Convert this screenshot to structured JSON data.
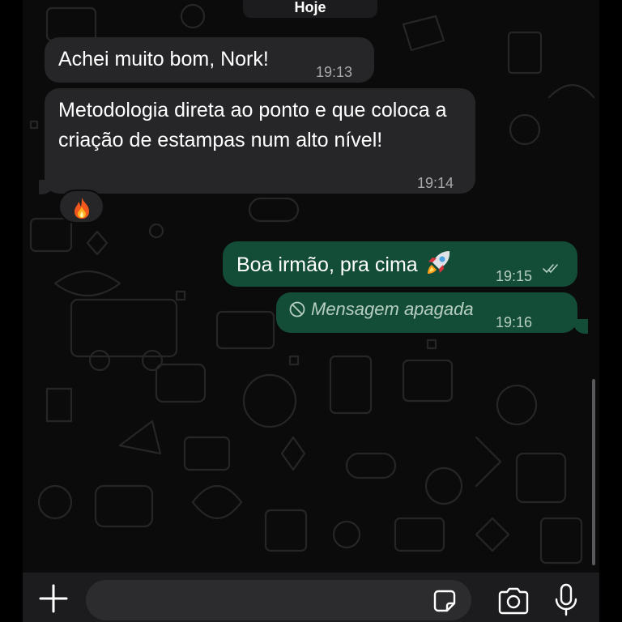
{
  "date_separator": "Hoje",
  "messages": [
    {
      "direction": "incoming",
      "text": "Achei muito bom, Nork!",
      "time": "19:13"
    },
    {
      "direction": "incoming",
      "text": "Metodologia direta ao ponto e que coloca a criação de estampas num alto nível!",
      "time": "19:14",
      "reaction": "fire-emoji"
    },
    {
      "direction": "outgoing",
      "text": "Boa irmão, pra cima",
      "emoji": "rocket-emoji",
      "time": "19:15",
      "status": "read-double-check"
    },
    {
      "direction": "outgoing",
      "text": "Mensagem apagada",
      "deleted": true,
      "time": "19:16"
    }
  ],
  "composer": {
    "placeholder": "",
    "icons": [
      "plus-icon",
      "sticker-icon",
      "camera-icon",
      "microphone-icon"
    ]
  },
  "colors": {
    "background": "#0b0b0b",
    "incoming_bubble": "#262628",
    "outgoing_bubble": "#144d37",
    "composer_bar": "#1c1c1e"
  }
}
